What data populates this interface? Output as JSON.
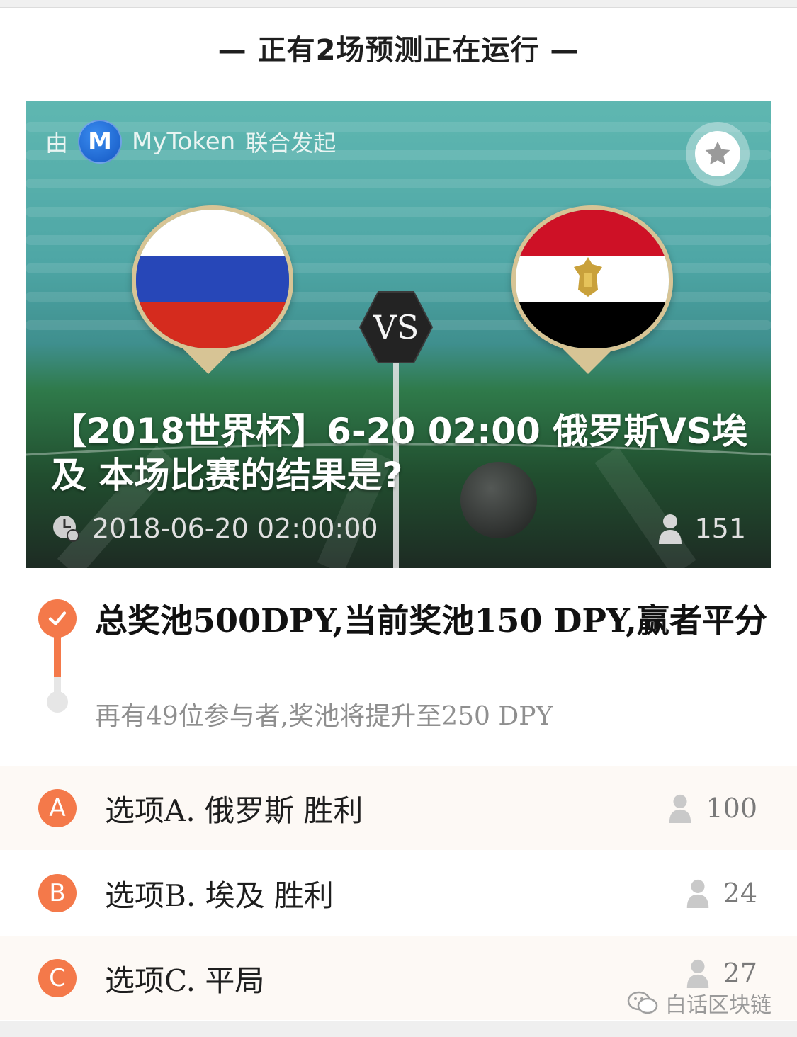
{
  "header": {
    "title": "— 正有2场预测正在运行 —"
  },
  "banner": {
    "by_prefix": "由",
    "brand": "MyToken",
    "by_suffix": "联合发起",
    "vs_text": "VS",
    "title": "【2018世界杯】6-20 02:00 俄罗斯VS埃及 本场比赛的结果是?",
    "time": "2018-06-20 02:00:00",
    "participants": "151",
    "team_left": "俄罗斯",
    "team_right": "埃及",
    "colors": {
      "russia": [
        "#ffffff",
        "#2747b8",
        "#d52b1e"
      ],
      "egypt": [
        "#ce1126",
        "#ffffff",
        "#000000"
      ],
      "gold": "#d7c495"
    }
  },
  "pool": {
    "title": "总奖池500DPY,当前奖池150 DPY,赢者平分",
    "subtitle": "再有49位参与者,奖池将提升至250 DPY"
  },
  "options": [
    {
      "letter": "A",
      "label": "选项A. 俄罗斯 胜利",
      "count": "100"
    },
    {
      "letter": "B",
      "label": "选项B. 埃及 胜利",
      "count": "24"
    },
    {
      "letter": "C",
      "label": "选项C. 平局",
      "count": "27"
    }
  ],
  "watermark": {
    "text": "白话区块链"
  },
  "accent": "#f4794a",
  "icons": [
    "check-icon",
    "star-icon",
    "clock-icon",
    "user-icon",
    "wechat-icon",
    "mytoken-logo-icon"
  ]
}
